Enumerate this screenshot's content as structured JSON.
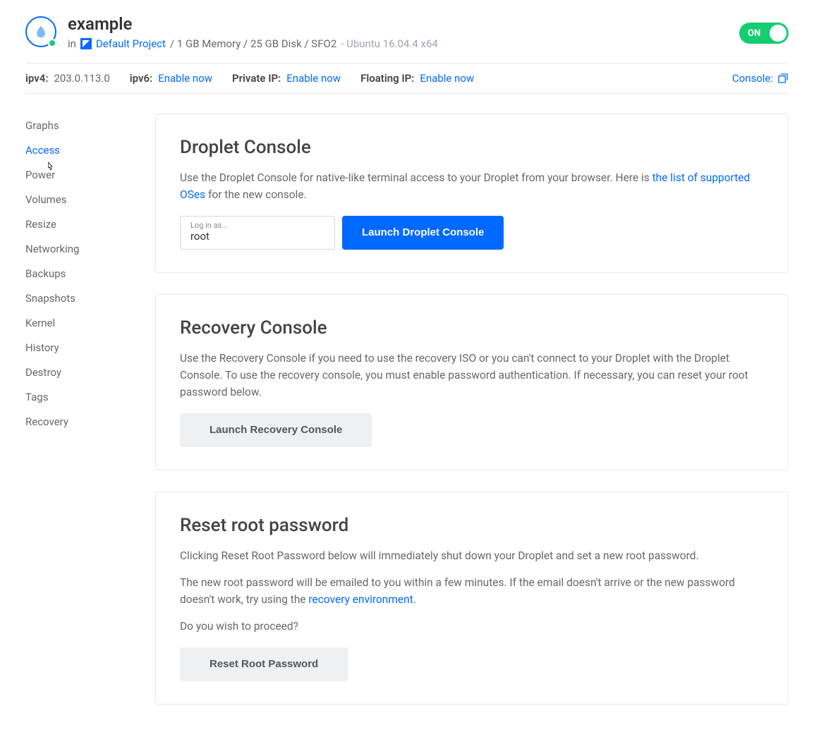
{
  "header": {
    "title": "example",
    "in_label": "in",
    "project_name": "Default Project",
    "specs": "/ 1 GB Memory / 25 GB Disk / SFO2",
    "os": "- Ubuntu 16.04.4 x64",
    "toggle_label": "ON"
  },
  "ipbar": {
    "ipv4_label": "ipv4:",
    "ipv4_value": "203.0.113.0",
    "ipv6_label": "ipv6:",
    "ipv6_link": "Enable now",
    "private_label": "Private IP:",
    "private_link": "Enable now",
    "floating_label": "Floating IP:",
    "floating_link": "Enable now",
    "console_label": "Console:"
  },
  "sidebar": {
    "items": [
      {
        "label": "Graphs"
      },
      {
        "label": "Access"
      },
      {
        "label": "Power"
      },
      {
        "label": "Volumes"
      },
      {
        "label": "Resize"
      },
      {
        "label": "Networking"
      },
      {
        "label": "Backups"
      },
      {
        "label": "Snapshots"
      },
      {
        "label": "Kernel"
      },
      {
        "label": "History"
      },
      {
        "label": "Destroy"
      },
      {
        "label": "Tags"
      },
      {
        "label": "Recovery"
      }
    ],
    "active_index": 1
  },
  "cards": {
    "droplet_console": {
      "title": "Droplet Console",
      "desc_pre": "Use the Droplet Console for native-like terminal access to your Droplet from your browser. Here is ",
      "desc_link": "the list of supported OSes",
      "desc_post": " for the new console.",
      "login_label": "Log in as...",
      "login_value": "root",
      "button": "Launch Droplet Console"
    },
    "recovery_console": {
      "title": "Recovery Console",
      "desc": "Use the Recovery Console if you need to use the recovery ISO or you can't connect to your Droplet with the Droplet Console. To use the recovery console, you must enable password authentication. If necessary, you can reset your root password below.",
      "button": "Launch Recovery Console"
    },
    "reset_root": {
      "title": "Reset root password",
      "p1": "Clicking Reset Root Password below will immediately shut down your Droplet and set a new root password.",
      "p2_pre": "The new root password will be emailed to you within a few minutes. If the email doesn't arrive or the new password doesn't work, try using the ",
      "p2_link": "recovery environment",
      "p2_post": ".",
      "p3": "Do you wish to proceed?",
      "button": "Reset Root Password"
    }
  }
}
